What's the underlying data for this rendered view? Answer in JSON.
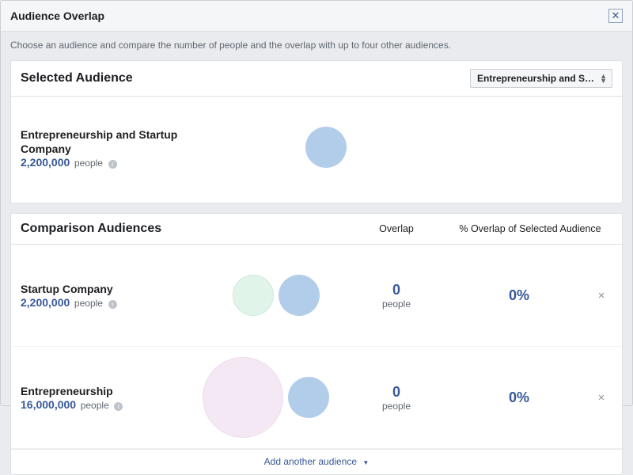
{
  "modal": {
    "title": "Audience Overlap",
    "subhead": "Choose an audience and compare the number of people and the overlap with up to four other audiences."
  },
  "selected": {
    "section_title": "Selected Audience",
    "dropdown_label": "Entrepreneurship and Startu…",
    "name": "Entrepreneurship and Startup Company",
    "people_count": "2,200,000",
    "people_label": "people"
  },
  "comparison": {
    "section_title": "Comparison Audiences",
    "overlap_header": "Overlap",
    "percent_header": "% Overlap of Selected Audience",
    "add_label": "Add another audience",
    "rows": [
      {
        "name": "Startup Company",
        "people_count": "2,200,000",
        "people_label": "people",
        "overlap_count": "0",
        "overlap_label": "people",
        "overlap_percent": "0%"
      },
      {
        "name": "Entrepreneurship",
        "people_count": "16,000,000",
        "people_label": "people",
        "overlap_count": "0",
        "overlap_label": "people",
        "overlap_percent": "0%"
      }
    ]
  },
  "glyphs": {
    "close_x": "✕",
    "small_x": "×",
    "info_i": "i",
    "tri_down": "▼"
  }
}
